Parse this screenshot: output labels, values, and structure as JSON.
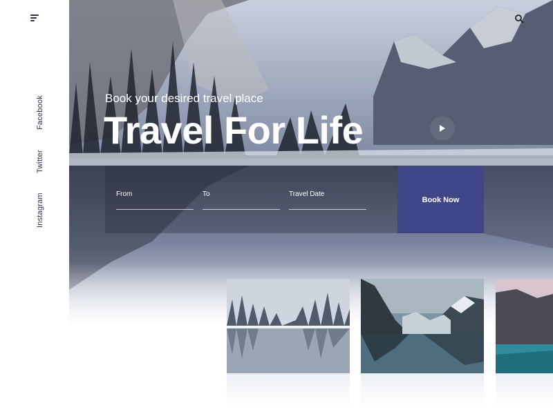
{
  "sidebar": {
    "menu_icon": "menu-icon",
    "social": [
      "Facebook",
      "Twitter",
      "Instagram"
    ]
  },
  "header": {
    "search_icon": "search-icon"
  },
  "hero": {
    "subtitle": "Book your desired travel place",
    "title": "Travel For Life",
    "play_icon": "play-icon"
  },
  "booking": {
    "from_label": "From",
    "to_label": "To",
    "date_label": "Travel Date",
    "from_value": "",
    "to_value": "",
    "date_value": "",
    "book_label": "Book Now",
    "accent": "#3e4687"
  },
  "gallery": [
    {
      "name": "misty-lake"
    },
    {
      "name": "mountain-lake"
    },
    {
      "name": "turquoise-lake"
    }
  ]
}
